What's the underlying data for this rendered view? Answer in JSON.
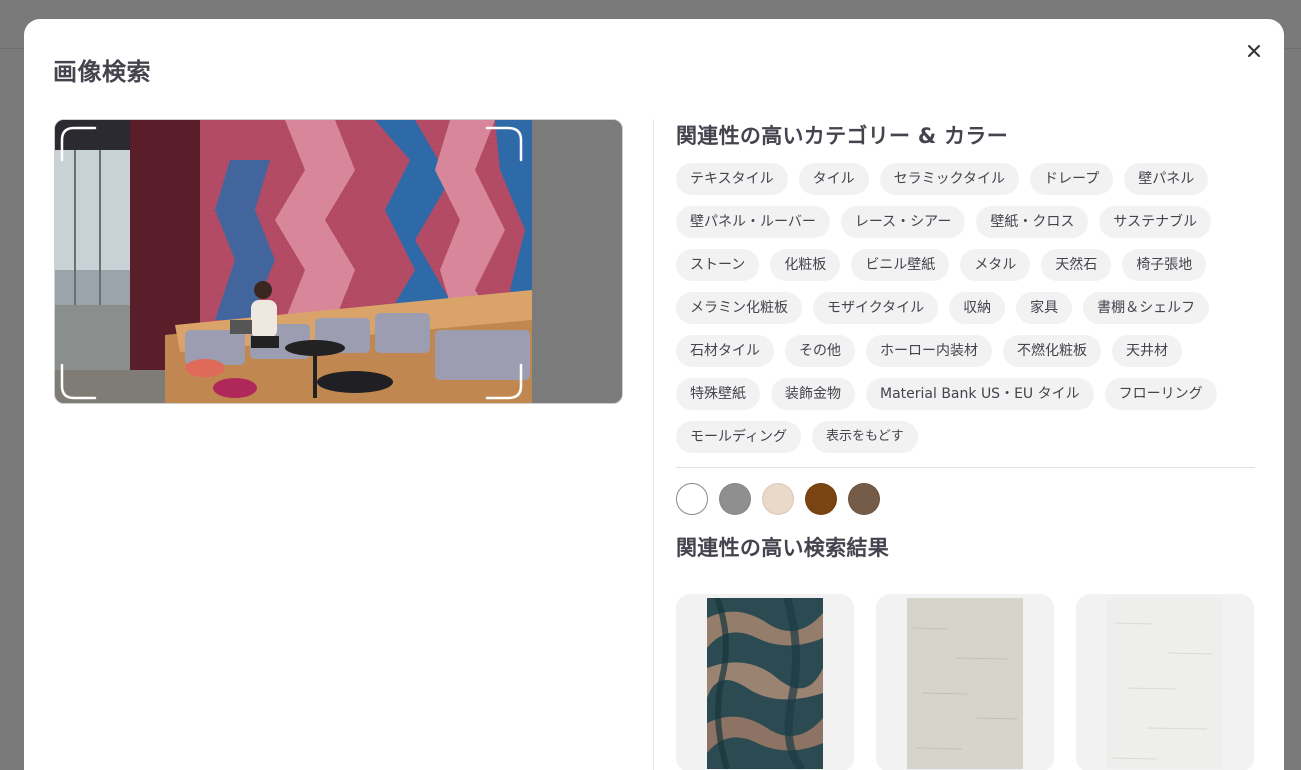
{
  "modal": {
    "title": "画像検索",
    "close_icon": "close-icon"
  },
  "preview": {
    "icon": "image-crop-frame"
  },
  "categories": {
    "title": "関連性の高いカテゴリー & カラー",
    "items": [
      "テキスタイル",
      "タイル",
      "セラミックタイル",
      "ドレープ",
      "壁パネル",
      "壁パネル・ルーバー",
      "レース・シアー",
      "壁紙・クロス",
      "サステナブル",
      "ストーン",
      "化粧板",
      "ビニル壁紙",
      "メタル",
      "天然石",
      "椅子張地",
      "メラミン化粧板",
      "モザイクタイル",
      "収納",
      "家具",
      "書棚＆シェルフ",
      "石材タイル",
      "その他",
      "ホーロー内装材",
      "不燃化粧板",
      "天井材",
      "特殊壁紙",
      "装飾金物",
      "Material Bank US・EU タイル",
      "フローリング",
      "モールディング"
    ],
    "show_less": "表示をもどす"
  },
  "colors": [
    "#ffffff",
    "#8f8f8f",
    "#ead9c8",
    "#7a4412",
    "#755c49"
  ],
  "results": {
    "title": "関連性の高い検索結果",
    "items": [
      {
        "texture": "granite-dark",
        "base": "#2c4a52"
      },
      {
        "texture": "stone-light-gray",
        "base": "#d6d5cc"
      },
      {
        "texture": "stone-white",
        "base": "#eeeeec"
      }
    ]
  }
}
